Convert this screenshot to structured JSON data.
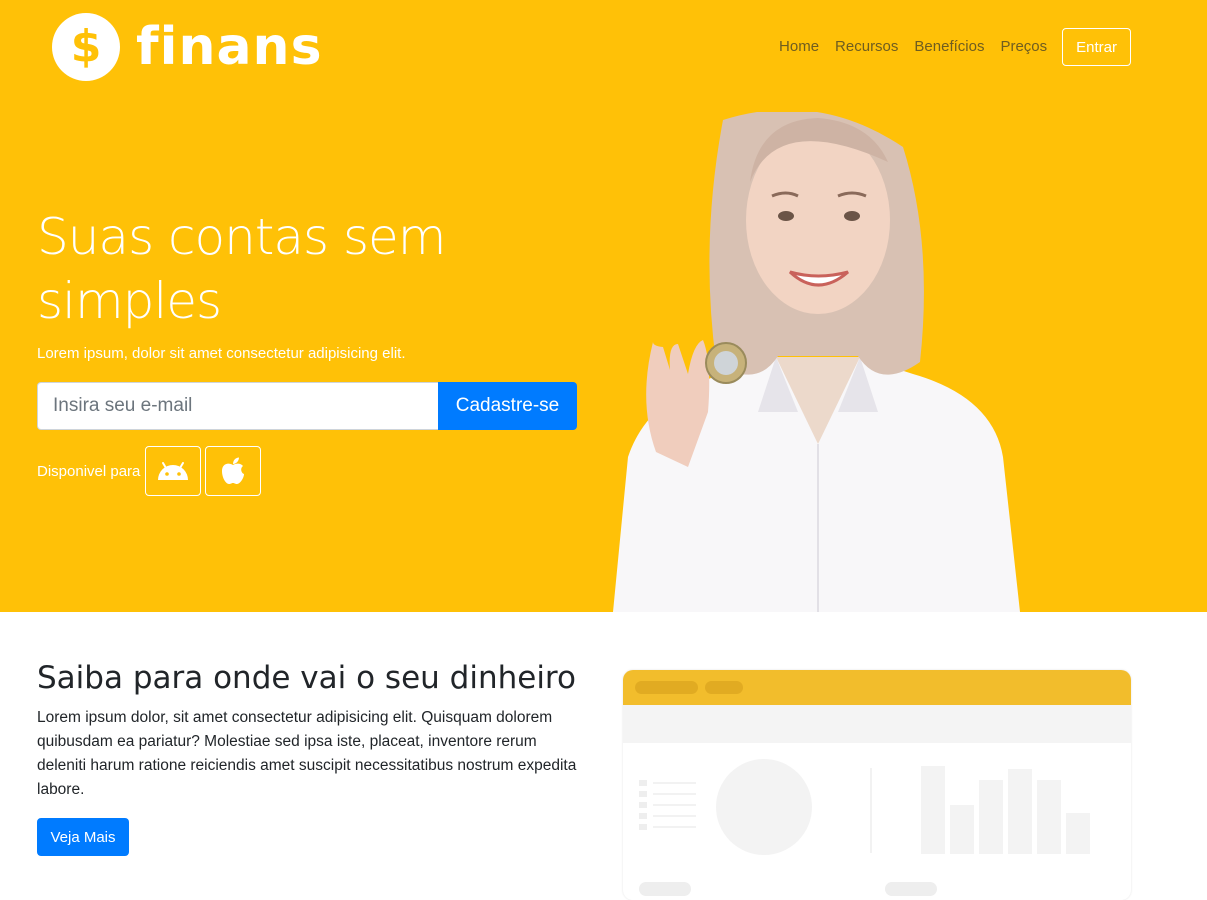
{
  "brand": {
    "name": "finans",
    "logo_glyph": "$"
  },
  "nav": {
    "items": [
      {
        "label": "Home"
      },
      {
        "label": "Recursos"
      },
      {
        "label": "Benefícios"
      },
      {
        "label": "Preços"
      }
    ],
    "login_label": "Entrar"
  },
  "hero": {
    "title": "Suas contas sem simples",
    "subtitle": "Lorem ipsum, dolor sit amet consectetur adipisicing elit.",
    "email_placeholder": "Insira seu e-mail",
    "email_value": "",
    "signup_label": "Cadastre-se",
    "available_label": "Disponivel para",
    "stores": [
      {
        "icon": "android-icon"
      },
      {
        "icon": "apple-icon"
      }
    ]
  },
  "section": {
    "title": "Saiba para onde vai o seu dinheiro",
    "text": "Lorem ipsum dolor, sit amet consectetur adipisicing elit. Quisquam dolorem quibusdam ea pariatur? Molestiae sed ipsa iste, placeat, inventore rerum deleniti harum ratione reiciendis amet suscipit necessitatibus nostrum expedita labore.",
    "button_label": "Veja Mais"
  },
  "colors": {
    "brand_yellow": "#ffc107",
    "primary_blue": "#007bff",
    "mockup_header": "#f2bd2c",
    "mockup_gray": "#f4f4f4"
  }
}
